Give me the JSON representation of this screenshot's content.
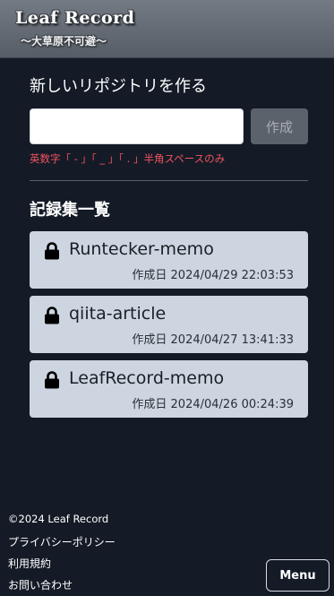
{
  "header": {
    "title": "Leaf Record",
    "subtitle": "〜大草原不可避〜"
  },
  "create": {
    "heading": "新しいリポジトリを作る",
    "input_value": "",
    "button_label": "作成",
    "hint": "英数字「 - 」「 _ 」「 . 」半角スペースのみ"
  },
  "list": {
    "heading": "記録集一覧",
    "items": [
      {
        "name": "Runtecker-memo",
        "created": "作成日 2024/04/29 22:03:53",
        "icon": "lock-icon"
      },
      {
        "name": "qiita-article",
        "created": "作成日 2024/04/27 13:41:33",
        "icon": "lock-icon"
      },
      {
        "name": "LeafRecord-memo",
        "created": "作成日 2024/04/26 00:24:39",
        "icon": "lock-icon"
      }
    ]
  },
  "footer": {
    "copyright": "©2024 Leaf Record",
    "links": [
      "プライバシーポリシー",
      "利用規約",
      "お問い合わせ"
    ],
    "menu_label": "Menu"
  },
  "colors": {
    "background": "#141b27",
    "header": "#5f666f",
    "card": "#cdd5e0",
    "hint": "#f0535e",
    "button_disabled": "#5b626c"
  }
}
